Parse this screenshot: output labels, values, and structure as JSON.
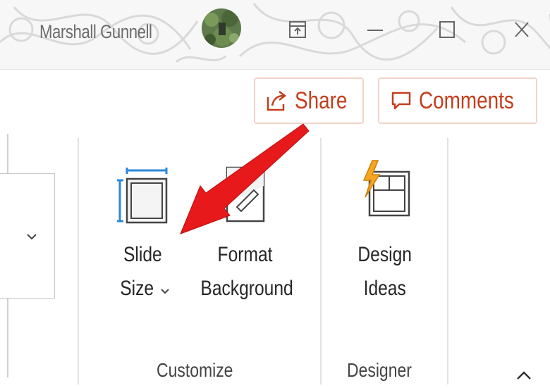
{
  "titlebar": {
    "user_name": "Marshall Gunnell"
  },
  "header_actions": {
    "share_label": "Share",
    "comments_label": "Comments"
  },
  "ribbon": {
    "customize": {
      "slide_size_line1": "Slide",
      "slide_size_line2": "Size",
      "format_bg_line1": "Format",
      "format_bg_line2": "Background",
      "group_label": "Customize"
    },
    "designer": {
      "design_ideas_line1": "Design",
      "design_ideas_line2": "Ideas",
      "group_label": "Designer"
    }
  },
  "colors": {
    "accent": "#c43e1c",
    "annotation_arrow": "#e8191a",
    "slide_size_blue": "#2b88d8",
    "lightning": "#f5a623"
  },
  "icons": {
    "share": "share-icon",
    "comments": "comment-icon",
    "slide_size": "slide-size-icon",
    "format_background": "format-background-icon",
    "design_ideas": "design-ideas-icon",
    "collapse": "chevron-up-icon"
  }
}
